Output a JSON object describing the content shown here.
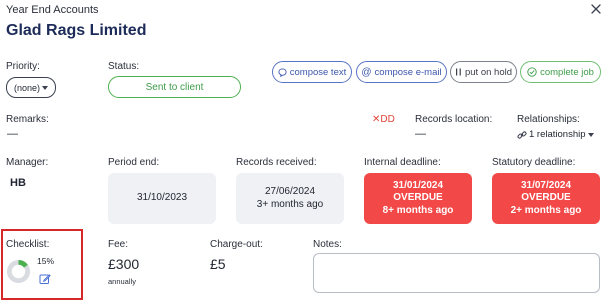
{
  "header": {
    "kicker": "Year End Accounts",
    "client_name": "Glad Rags Limited"
  },
  "priority": {
    "label": "Priority:",
    "value": "(none)"
  },
  "status": {
    "label": "Status:",
    "value": "Sent to client"
  },
  "actions": {
    "compose_text": "compose text",
    "compose_email": "compose e-mail",
    "put_on_hold": "put on hold",
    "complete_job": "complete job"
  },
  "remarks": {
    "label": "Remarks:",
    "value": "—"
  },
  "dd_flag": "DD",
  "records_location": {
    "label": "Records location:",
    "value": "—"
  },
  "relationships": {
    "label": "Relationships:",
    "value": "1 relationship"
  },
  "manager": {
    "label": "Manager:",
    "value": "HB"
  },
  "period_end": {
    "label": "Period end:",
    "date": "31/10/2023"
  },
  "records_received": {
    "label": "Records received:",
    "date": "27/06/2024",
    "ago": "3+ months ago"
  },
  "internal_deadline": {
    "label": "Internal deadline:",
    "date": "31/01/2024",
    "status": "OVERDUE",
    "ago": "8+ months ago"
  },
  "statutory_deadline": {
    "label": "Statutory deadline:",
    "date": "31/07/2024",
    "status": "OVERDUE",
    "ago": "2+ months ago"
  },
  "checklist": {
    "label": "Checklist:",
    "percent_text": "15%",
    "progress": 0.15
  },
  "fee": {
    "label": "Fee:",
    "value": "£300",
    "frequency": "annually"
  },
  "charge_out": {
    "label": "Charge-out:",
    "value": "£5"
  },
  "notes": {
    "label": "Notes:",
    "value": ""
  },
  "colors": {
    "overdue": "#f24848",
    "status_green": "#4caf50",
    "action_blue": "#3d57ad",
    "title_navy": "#1d2b59",
    "highlight_red": "#d62828"
  },
  "icons": [
    "close-icon",
    "chat-bubble-icon",
    "at-sign-icon",
    "pause-icon",
    "check-circle-icon",
    "cross-icon",
    "link-icon",
    "chevron-down-icon",
    "donut-progress-icon",
    "edit-icon"
  ]
}
